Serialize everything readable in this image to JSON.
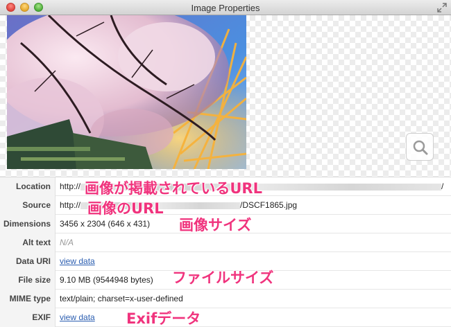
{
  "window": {
    "title": "Image Properties"
  },
  "colors": {
    "annotation": "#f0337d",
    "link": "#2a5db0"
  },
  "rows": [
    {
      "label": "Location",
      "value": "http://",
      "value_tail": "/"
    },
    {
      "label": "Source",
      "value": "http://",
      "value_tail": "/DSCF1865.jpg"
    },
    {
      "label": "Dimensions",
      "value": "3456 x 2304 (646 x 431)"
    },
    {
      "label": "Alt text",
      "value": "N/A"
    },
    {
      "label": "Data URI",
      "value": "view data"
    },
    {
      "label": "File size",
      "value": "9.10 MB (9544948 bytes)"
    },
    {
      "label": "MIME type",
      "value": "text/plain; charset=x-user-defined"
    },
    {
      "label": "EXIF",
      "value": "view data"
    }
  ],
  "annotations": {
    "location": "画像が掲載されているURL",
    "source": "画像のURL",
    "dimensions": "画像サイズ",
    "filesize": "ファイルサイズ",
    "exif": "Exifデータ"
  },
  "icons": {
    "zoom": "magnifier-icon",
    "fullscreen": "fullscreen-icon"
  }
}
